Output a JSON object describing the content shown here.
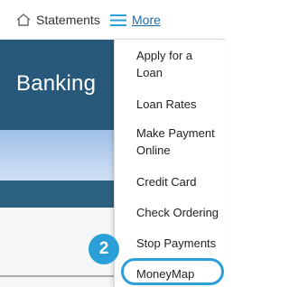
{
  "nav": {
    "statements_label": "Statements",
    "more_label": "More"
  },
  "hero": {
    "title": "Banking"
  },
  "dropdown": {
    "items": [
      "Apply for a Loan",
      "Loan Rates",
      "Make Payment Online",
      "Credit Card",
      "Check Ordering",
      "Stop Payments",
      "MoneyMap"
    ]
  },
  "annotation": {
    "step_number": "2",
    "highlight_color": "#2a9fd8"
  },
  "colors": {
    "brand_dark": "#28597a",
    "link": "#1a6aa6"
  }
}
